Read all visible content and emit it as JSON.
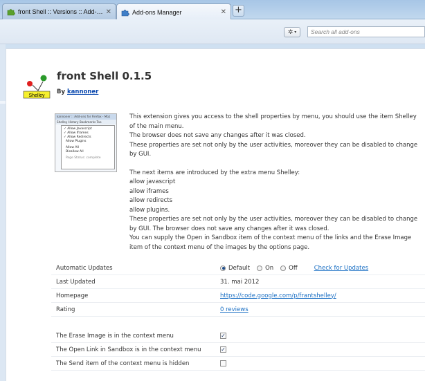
{
  "tabs": [
    {
      "label": "front Shell :: Versions :: Add-ons f...",
      "active": false
    },
    {
      "label": "Add-ons Manager",
      "active": true
    }
  ],
  "toolbar": {
    "search_placeholder": "Search all add-ons"
  },
  "addon": {
    "logo_text": "Shelley",
    "title": "front Shell  0.1.5",
    "by_label": "By",
    "author": "kannoner",
    "screenshot": {
      "title_bar": "kannoner :: Add-ons for Firefox - Moz",
      "menu_bar": "Shelley  History  Bookmarks  Too",
      "menu_items": [
        "Allow Javascript",
        "Allow Iframes",
        "Allow Redirects",
        "Allow Plugins",
        "Allow All",
        "Disallow All",
        "Page Status: complete"
      ]
    },
    "description": [
      "This extension gives you access to the shell properties by menu, you should use the item Shelley of the main menu.",
      "The browser does not save any changes after it was closed.",
      "These properties are set not only by the user activities, moreover they can be disabled to change by GUI.",
      "",
      "The next items are introduced by the extra menu Shelley:",
      "allow javascript",
      "allow iframes",
      "allow redirects",
      "allow plugins.",
      "These properties are set not only by the user activities, moreover they can be disabled to change by GUI. The browser does not save any changes after it was closed.",
      "You can supply the Open in Sandbox item of the context menu of the links and the Erase Image item of the context menu of the images by the options page."
    ]
  },
  "details": {
    "auto_updates_label": "Automatic Updates",
    "auto_updates_options": [
      "Default",
      "On",
      "Off"
    ],
    "auto_updates_selected": "Default",
    "check_updates": "Check for Updates",
    "last_updated_label": "Last Updated",
    "last_updated_value": "31. mai 2012",
    "homepage_label": "Homepage",
    "homepage_value": "https://code.google.com/p/frantshelley/",
    "rating_label": "Rating",
    "rating_value": "0 reviews"
  },
  "options": [
    {
      "label": "The Erase Image is in the context menu",
      "checked": true
    },
    {
      "label": "The Open Link in Sandbox is in the context menu",
      "checked": true
    },
    {
      "label": "The Send item of the context menu is hidden",
      "checked": false
    }
  ]
}
